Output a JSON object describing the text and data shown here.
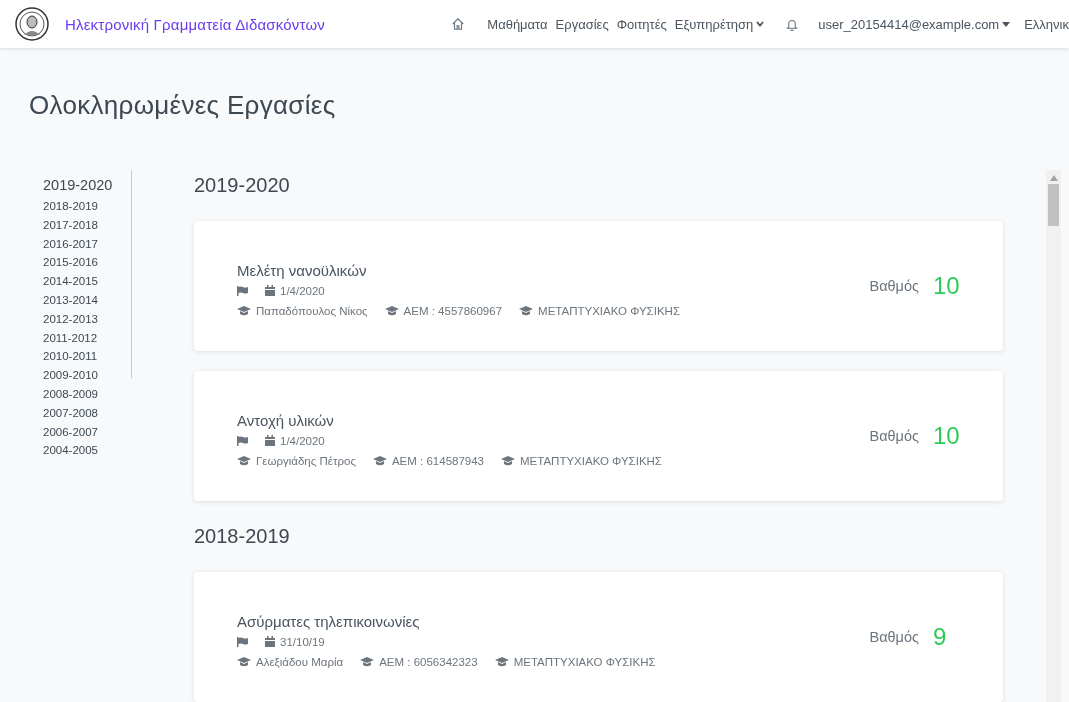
{
  "navbar": {
    "brand": "Ηλεκτρονική Γραμματεία Διδασκόντων",
    "links": [
      "Μαθήματα",
      "Εργασίες",
      "Φοιτητές"
    ],
    "menu": "Εξυπηρέτηση",
    "user": "user_20154414@example.com",
    "language": "Ελληνικ"
  },
  "page_title": "Ολοκληρωμένες Εργασίες",
  "years": [
    {
      "label": "2019-2020",
      "selected": true
    },
    {
      "label": "2018-2019",
      "selected": false
    },
    {
      "label": "2017-2018",
      "selected": false
    },
    {
      "label": "2016-2017",
      "selected": false
    },
    {
      "label": "2015-2016",
      "selected": false
    },
    {
      "label": "2014-2015",
      "selected": false
    },
    {
      "label": "2013-2014",
      "selected": false
    },
    {
      "label": "2012-2013",
      "selected": false
    },
    {
      "label": "2011-2012",
      "selected": false
    },
    {
      "label": "2010-2011",
      "selected": false
    },
    {
      "label": "2009-2010",
      "selected": false
    },
    {
      "label": "2008-2009",
      "selected": false
    },
    {
      "label": "2007-2008",
      "selected": false
    },
    {
      "label": "2006-2007",
      "selected": false
    },
    {
      "label": "2004-2005",
      "selected": false
    }
  ],
  "sections": [
    {
      "year": "2019-2020",
      "works": [
        {
          "title": "Μελέτη νανοϋλικών",
          "date": "1/4/2020",
          "student": "Παπαδόπουλος Νίκος",
          "aem": "ΑΕΜ : 4557860967",
          "program": "ΜΕΤΑΠΤΥΧΙΑΚΟ ΦΥΣΙΚΗΣ",
          "grade_label": "Βαθμός",
          "grade": "10"
        },
        {
          "title": "Αντοχή υλικών",
          "date": "1/4/2020",
          "student": "Γεωργιάδης Πέτρος",
          "aem": "ΑΕΜ : 614587943",
          "program": "ΜΕΤΑΠΤΥΧΙΑΚΟ ΦΥΣΙΚΗΣ",
          "grade_label": "Βαθμός",
          "grade": "10"
        }
      ]
    },
    {
      "year": "2018-2019",
      "works": [
        {
          "title": "Ασύρματες τηλεπικοινωνίες",
          "date": "31/10/19",
          "student": "Αλεξιάδου Μαρία",
          "aem": "ΑΕΜ : 6056342323",
          "program": "ΜΕΤΑΠΤΥΧΙΑΚΟ ΦΥΣΙΚΗΣ",
          "grade_label": "Βαθμός",
          "grade": "9"
        }
      ]
    }
  ]
}
